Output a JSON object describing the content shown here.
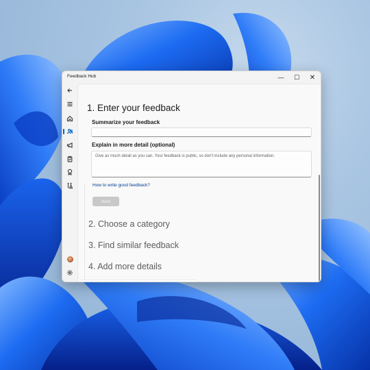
{
  "window": {
    "title": "Feedback Hub",
    "controls": {
      "minimize": "—",
      "maximize": "☐",
      "close": "✕"
    }
  },
  "nav": {
    "selected": "feedback",
    "icons": [
      "back-arrow",
      "hamburger-menu",
      "home",
      "feedback-people",
      "megaphone",
      "clipboard",
      "trophy",
      "beaker-lab",
      "user-avatar",
      "gear"
    ]
  },
  "form": {
    "step1_title": "1. Enter your feedback",
    "summary_label": "Summarize your feedback",
    "summary_value": "",
    "detail_label": "Explain in more detail (optional)",
    "detail_placeholder": "Give as much detail as you can. Your feedback is public, so don't include any personal information.",
    "howto_link": "How to write good feedback?",
    "next_button": "Next",
    "step2_title": "2. Choose a category",
    "step3_title": "3. Find similar feedback",
    "step4_title": "4. Add more details"
  },
  "colors": {
    "accent": "#0067c0",
    "link": "#003e92",
    "disabled_button": "#c8c8c8",
    "wallpaper_blue": "#0a55e8"
  }
}
